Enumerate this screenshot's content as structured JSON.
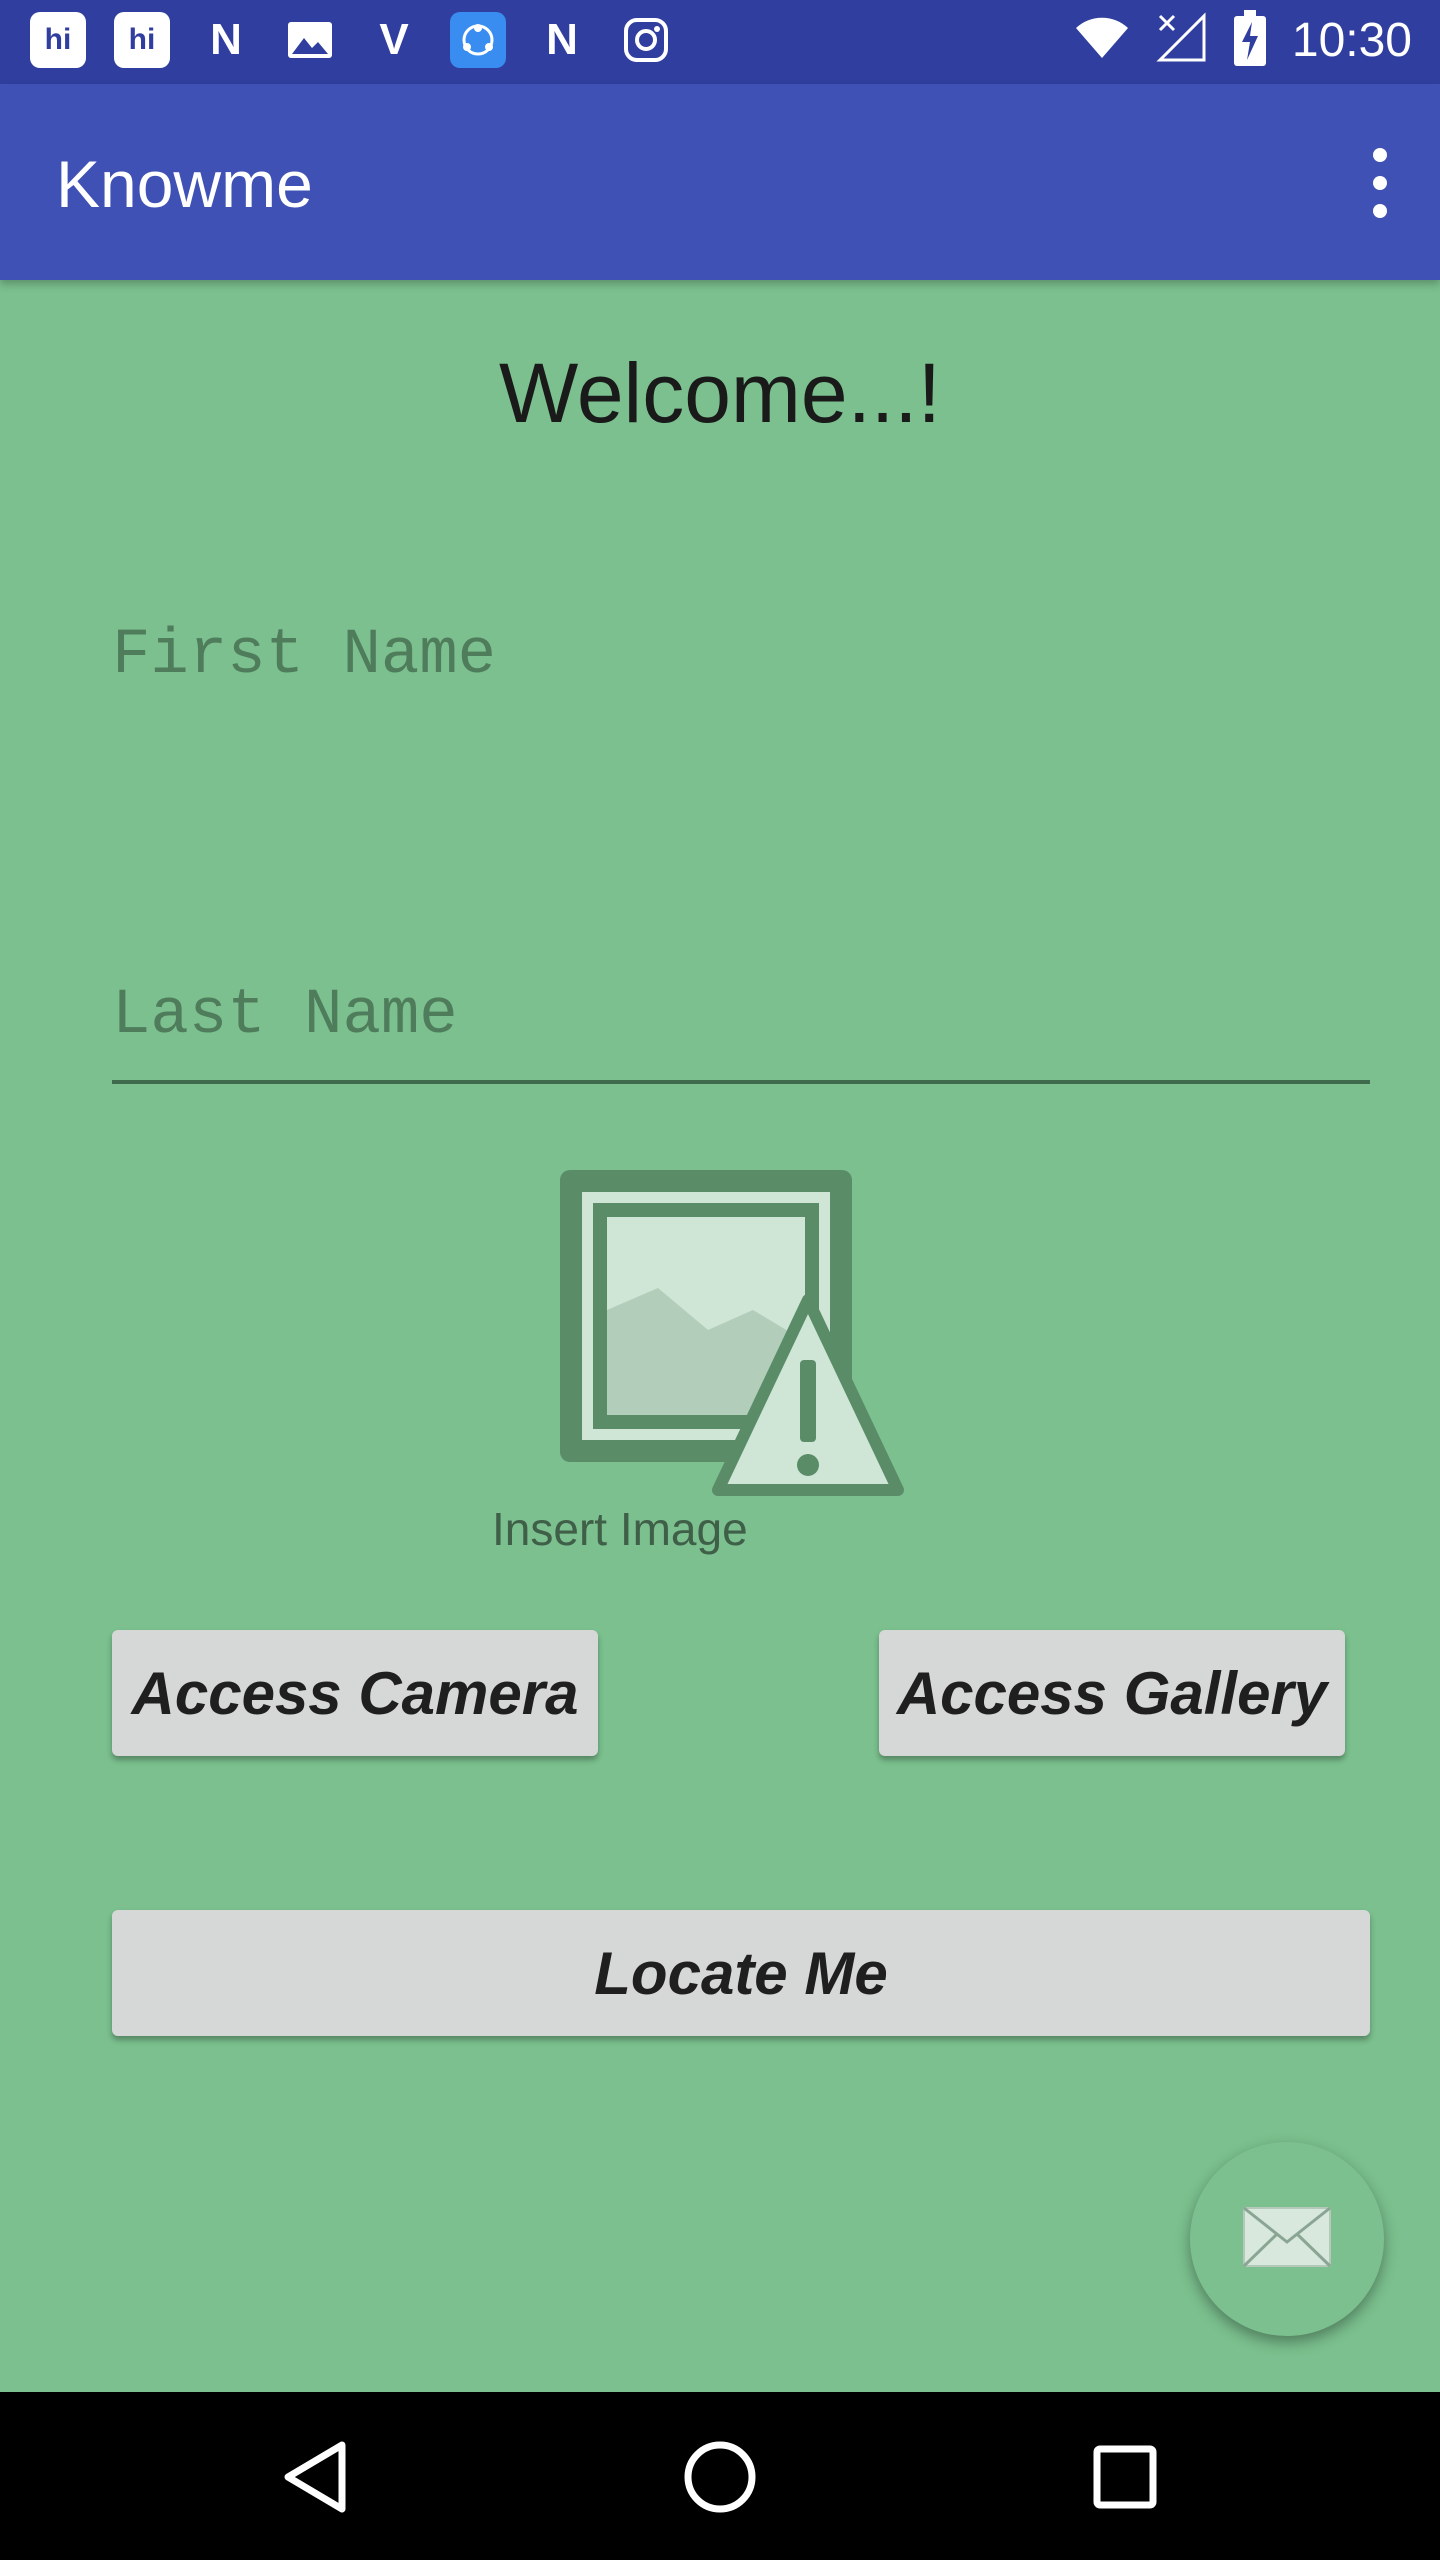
{
  "status_bar": {
    "icons": [
      "hi",
      "hi",
      "N",
      "image",
      "V",
      "share",
      "N",
      "instagram"
    ],
    "time": "10:30",
    "right_icons": [
      "wifi-icon",
      "no-signal-icon",
      "battery-charging-icon"
    ]
  },
  "app_bar": {
    "title": "Knowme",
    "overflow_icon": "more-vert-icon"
  },
  "main": {
    "welcome": "Welcome...!",
    "first_name_placeholder": "First Name",
    "last_name_placeholder": "Last Name",
    "image_icon": "broken-image-icon",
    "insert_image_label": "Insert Image",
    "access_camera_label": "Access Camera",
    "access_gallery_label": "Access Gallery",
    "locate_me_label": "Locate Me",
    "fab_icon": "mail-icon"
  },
  "colors": {
    "status_bar": "#303f9f",
    "app_bar": "#3f51b5",
    "background": "#7bc08e",
    "button": "#d6d7d7"
  }
}
